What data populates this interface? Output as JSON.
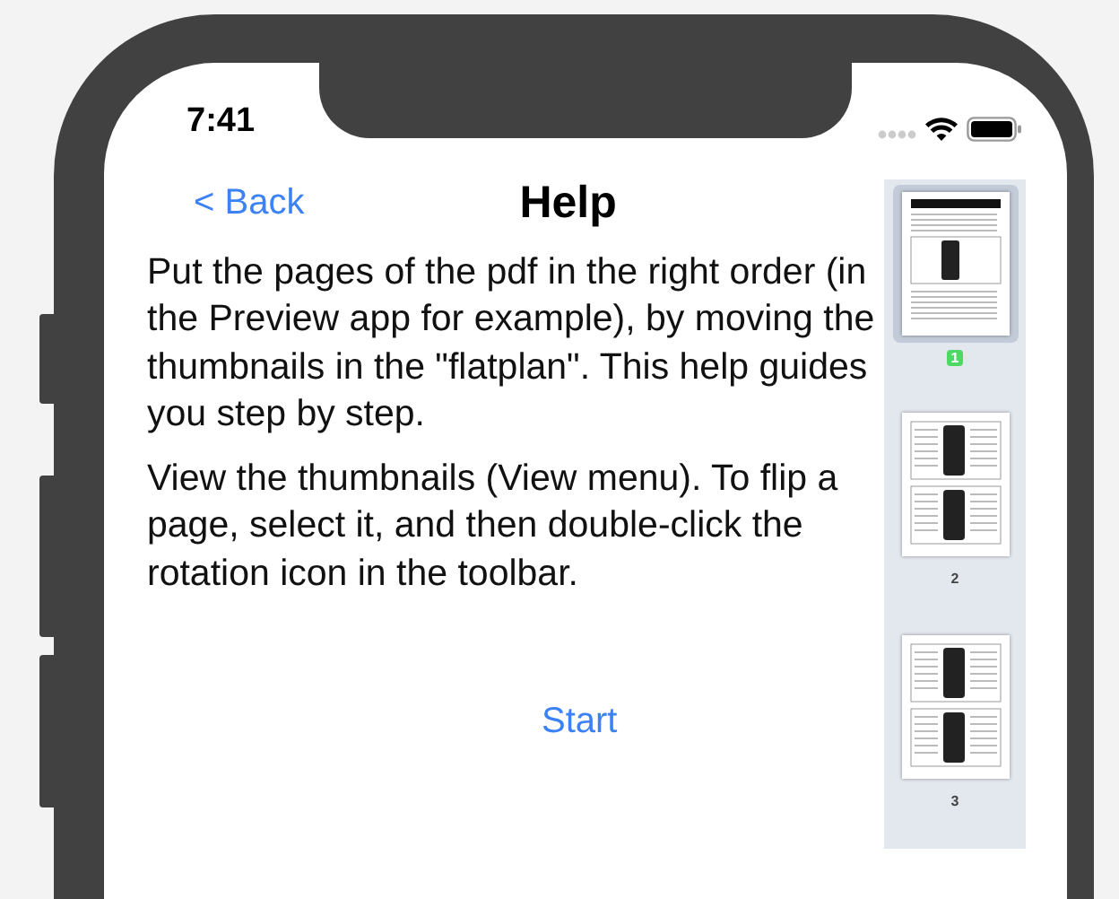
{
  "status_bar": {
    "time": "7:41"
  },
  "nav": {
    "back": "< Back",
    "title": "Help"
  },
  "paragraphs": [
    "Put the pages of the pdf in the right order (in the Preview app for example), by moving the thumbnails in the \"flatplan\". This help guides you step by step.",
    "View the thumbnails (View menu). To flip a page, select it, and then double-click the rotation icon in the toolbar."
  ],
  "start_button": "Start",
  "thumbnails": [
    {
      "label": "1",
      "selected": true
    },
    {
      "label": "2",
      "selected": false
    },
    {
      "label": "3",
      "selected": false
    }
  ]
}
